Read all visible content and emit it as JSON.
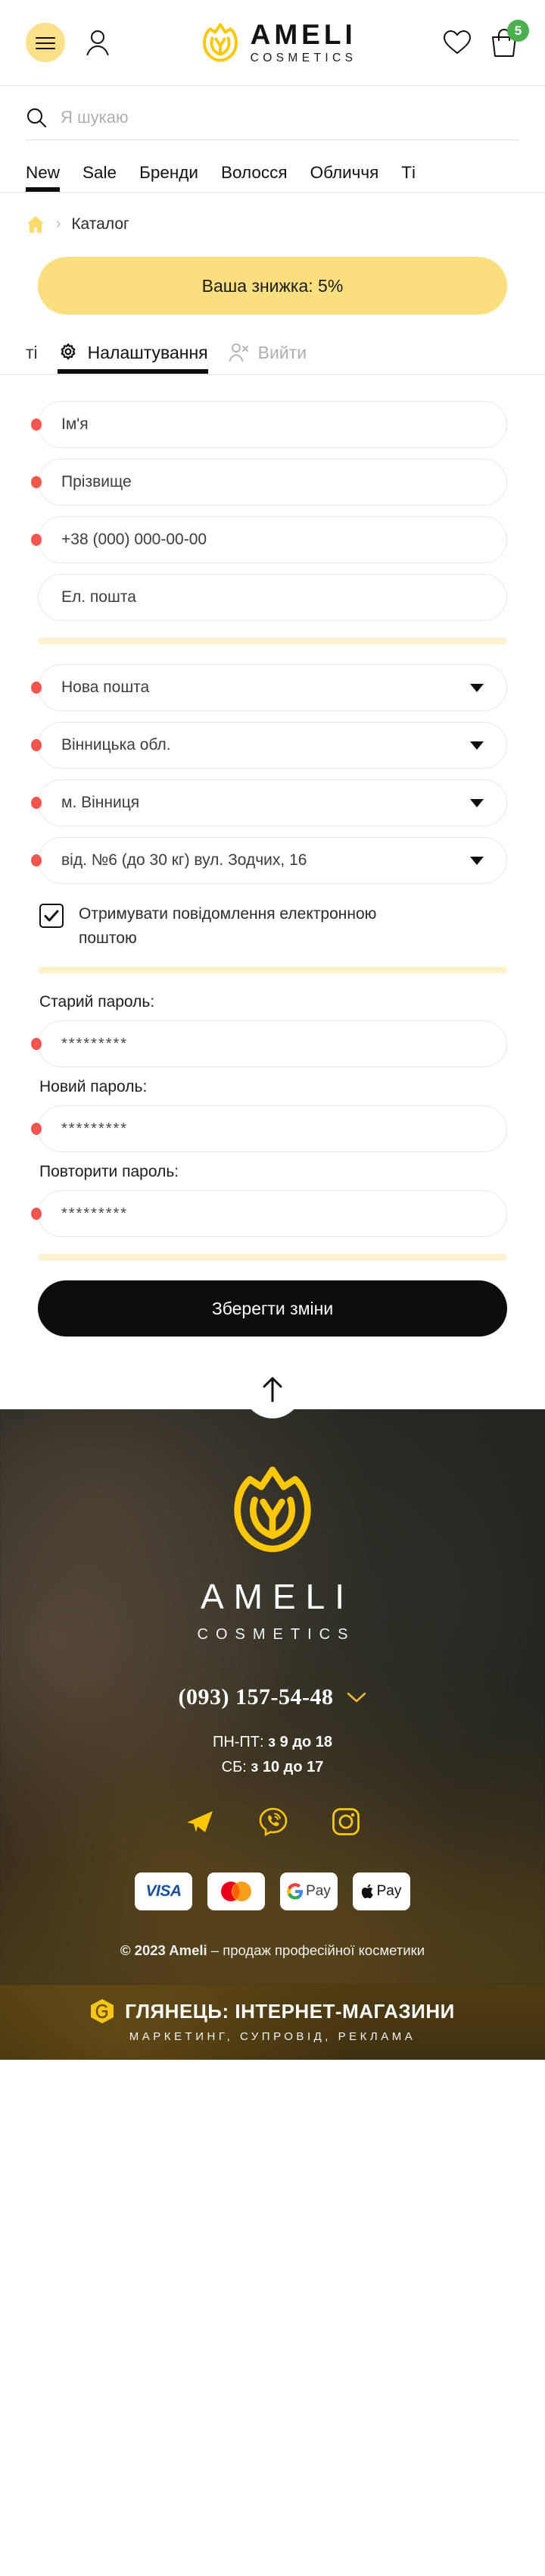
{
  "header": {
    "menu_icon": "hamburger-icon",
    "account_icon": "person-icon",
    "brand_name": "AMELI",
    "brand_sub": "COSMETICS",
    "wishlist_icon": "heart-icon",
    "cart_icon": "shopping-bag-icon",
    "cart_count": "5"
  },
  "search": {
    "icon": "search-icon",
    "placeholder": "Я шукаю",
    "value": ""
  },
  "nav": {
    "items": [
      {
        "label": "New",
        "active": true
      },
      {
        "label": "Sale",
        "active": false
      },
      {
        "label": "Бренди",
        "active": false
      },
      {
        "label": "Волосся",
        "active": false
      },
      {
        "label": "Обличчя",
        "active": false
      },
      {
        "label": "Ті",
        "active": false
      }
    ]
  },
  "breadcrumb": {
    "home_icon": "home-icon",
    "separator": "›",
    "current": "Каталог"
  },
  "discount": {
    "text": "Ваша знижка: 5%"
  },
  "account_tabs": {
    "clipped_left": "ті",
    "settings": {
      "icon": "gear-icon",
      "label": "Налаштування",
      "active": true
    },
    "logout": {
      "icon": "person-exit-icon",
      "label": "Вийти",
      "active": false
    }
  },
  "form": {
    "first_name": {
      "value": "Ім'я",
      "required": true
    },
    "last_name": {
      "value": "Прізвище",
      "required": true
    },
    "phone": {
      "value": "+38 (000) 000-00-00",
      "required": true
    },
    "email": {
      "value": "Ел. пошта",
      "required": false
    },
    "delivery_service": {
      "value": "Нова пошта",
      "required": true
    },
    "region": {
      "value": "Вінницька обл.",
      "required": true
    },
    "city": {
      "value": "м. Вінниця",
      "required": true
    },
    "branch": {
      "value": "від. №6 (до 30 кг) вул. Зодчих, 16",
      "required": true
    },
    "newsletter": {
      "checked": true,
      "label": "Отримувати повідомлення електронною поштою"
    },
    "old_password": {
      "label": "Старий пароль:",
      "value": "*********",
      "required": true
    },
    "new_password": {
      "label": "Новий пароль:",
      "value": "*********",
      "required": true
    },
    "repeat_password": {
      "label": "Повторити пароль:",
      "value": "*********",
      "required": true
    },
    "save_button": "Зберегти зміни"
  },
  "scroll_top": {
    "icon": "arrow-up-icon"
  },
  "footer": {
    "logo_icon": "ameli-tulip-logo",
    "brand_name": "AMELI",
    "brand_sub": "COSMETICS",
    "phone": "(093) 157-54-48",
    "phone_chevron": "chevron-down-icon",
    "hours_weekday_label": "ПН-ПТ: ",
    "hours_weekday_value": "з 9 до 18",
    "hours_saturday_label": "СБ: ",
    "hours_saturday_value": "з 10 до 17",
    "socials": [
      {
        "name": "telegram-icon"
      },
      {
        "name": "viber-icon"
      },
      {
        "name": "instagram-icon"
      }
    ],
    "payments": [
      {
        "name": "visa-logo",
        "label": "VISA"
      },
      {
        "name": "mastercard-logo",
        "label": ""
      },
      {
        "name": "google-pay-logo",
        "label": "Pay"
      },
      {
        "name": "apple-pay-logo",
        "label": "Pay"
      }
    ],
    "copyright_bold": "© 2023 Ameli",
    "copyright_rest": " – продаж професійної косметики"
  },
  "bottom_bar": {
    "logo_icon": "hlyanets-g-logo",
    "title": "ГЛЯНЕЦЬ: ІНТЕРНЕТ-МАГАЗИНИ",
    "subtitle": "МАРКЕТИНГ, СУПРОВІД, РЕКЛАМА"
  },
  "colors": {
    "brand_yellow": "#FBC707",
    "banner_yellow": "#FBDF7F",
    "required_red": "#F4564E",
    "badge_green": "#4CAF50",
    "dark": "#0D0D0D"
  }
}
